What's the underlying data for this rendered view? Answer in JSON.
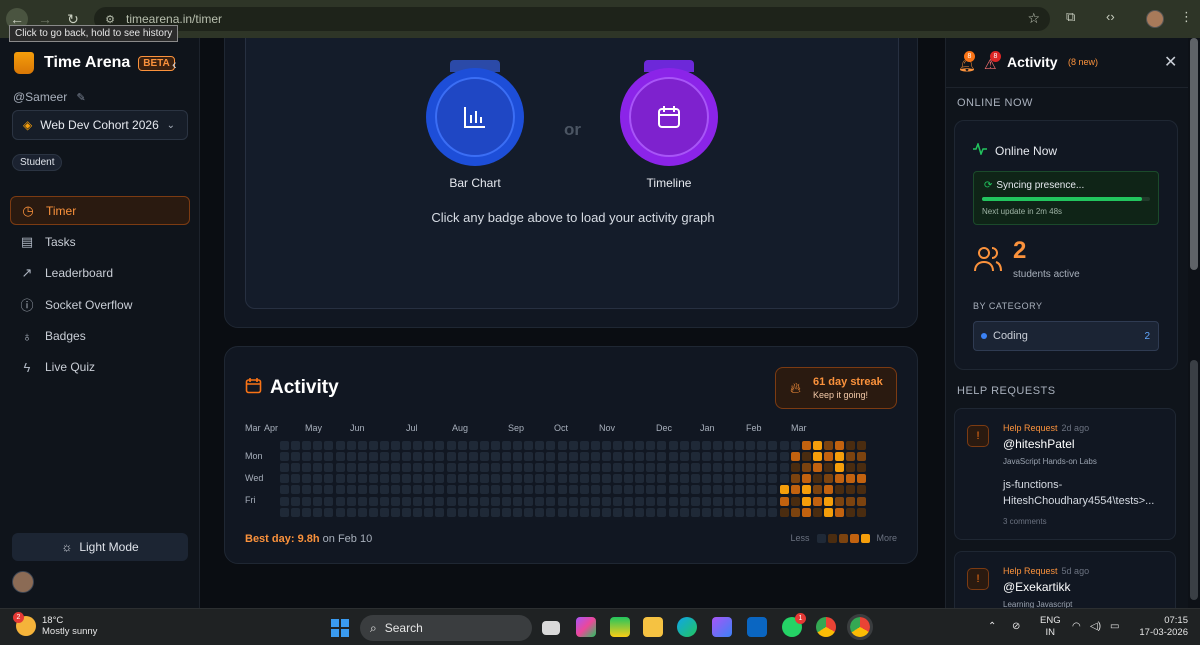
{
  "browser": {
    "url": "timearena.in/timer",
    "tooltip": "Click to go back, hold to see history"
  },
  "sidebar": {
    "brand": "Time Arena",
    "beta": "BETA",
    "username": "@Sameer",
    "cohort": "Web Dev Cohort 2026",
    "role": "Student",
    "items": [
      {
        "label": "Timer",
        "icon": "timer-icon",
        "active": true
      },
      {
        "label": "Tasks",
        "icon": "clipboard-icon",
        "active": false
      },
      {
        "label": "Leaderboard",
        "icon": "trending-icon",
        "active": false
      },
      {
        "label": "Socket Overflow",
        "icon": "alert-circle-icon",
        "active": false
      },
      {
        "label": "Badges",
        "icon": "award-icon",
        "active": false
      },
      {
        "label": "Live Quiz",
        "icon": "zap-icon",
        "active": false
      }
    ],
    "light_mode": "Light Mode"
  },
  "graph_picker": {
    "bar_chart_label": "Bar Chart",
    "or": "or",
    "timeline_label": "Timeline",
    "hint": "Click any badge above to load your activity graph"
  },
  "activity": {
    "title": "Activity",
    "streak_title": "61 day streak",
    "streak_sub": "Keep it going!",
    "months": [
      "Mar",
      "Apr",
      "May",
      "Jun",
      "Jul",
      "Aug",
      "Sep",
      "Oct",
      "Nov",
      "Dec",
      "Jan",
      "Feb",
      "Mar"
    ],
    "day_labels": [
      "Mon",
      "Wed",
      "Fri"
    ],
    "best_day_label": "Best day:",
    "best_day_value": "9.8h",
    "best_day_date": "on Feb 10",
    "legend_less": "Less",
    "legend_more": "More",
    "colors": {
      "empty": "#1f2937",
      "l1": "#4a2c10",
      "l2": "#7c430f",
      "l3": "#c2620f",
      "l4": "#f59e0b"
    }
  },
  "panel": {
    "title": "Activity",
    "new_count": "(8 new)",
    "bell_count": "8",
    "alert_count": "8",
    "online_now_section": "ONLINE NOW",
    "online_now_title": "Online Now",
    "sync_text": "Syncing presence...",
    "sync_progress": 0.95,
    "next_update": "Next update in 2m 48s",
    "students_count": "2",
    "students_label": "students active",
    "by_category": "BY CATEGORY",
    "category_name": "Coding",
    "category_count": "2",
    "help_section": "HELP REQUESTS",
    "requests": [
      {
        "tag": "Help Request",
        "ago": "2d ago",
        "user": "@hiteshPatel",
        "topic": "JavaScript Hands-on Labs",
        "path": "js-functions-HiteshChoudhary4554\\tests>...",
        "comments": "3 comments"
      },
      {
        "tag": "Help Request",
        "ago": "5d ago",
        "user": "@Exekartikk",
        "topic": "Learning Javascript"
      }
    ]
  },
  "taskbar": {
    "temp": "18°C",
    "weather": "Mostly sunny",
    "weather_badge": "2",
    "search": "Search",
    "whatsapp_badge": "1",
    "lang1": "ENG",
    "lang2": "IN",
    "time": "07:15",
    "date": "17-03-2026"
  }
}
